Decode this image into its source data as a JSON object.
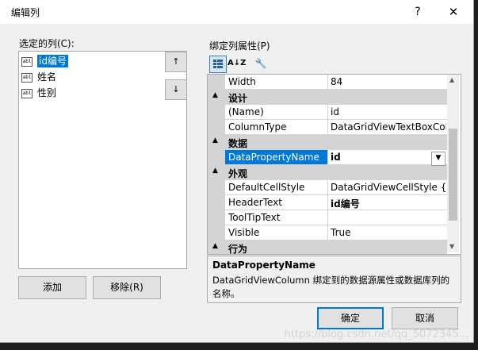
{
  "window": {
    "title": "编辑列",
    "help": "?",
    "close": "✕"
  },
  "left": {
    "label": "选定的列(C):",
    "columns": [
      {
        "name": "id编号",
        "icon": "abl",
        "selected": true
      },
      {
        "name": "姓名",
        "icon": "abl",
        "selected": false
      },
      {
        "name": "性别",
        "icon": "abl",
        "selected": false
      }
    ],
    "move_up": "↑",
    "move_down": "↓",
    "add_label": "添加",
    "remove_label": "移除(R)"
  },
  "right": {
    "label": "绑定列属性(P)",
    "toolbar": {
      "categorized": "categorized-icon",
      "alphabetical": "A↓Z",
      "property_pages": "wrench-icon"
    },
    "rows": [
      {
        "type": "prop",
        "name": "Width",
        "value": "84"
      },
      {
        "type": "cat",
        "name": "设计",
        "toggle": "▲"
      },
      {
        "type": "prop",
        "name": "(Name)",
        "value": "id"
      },
      {
        "type": "prop",
        "name": "ColumnType",
        "value": "DataGridViewTextBoxColu"
      },
      {
        "type": "cat",
        "name": "数据",
        "toggle": "▲"
      },
      {
        "type": "prop",
        "name": "DataPropertyName",
        "value": "id",
        "selected": true,
        "bold": true
      },
      {
        "type": "cat",
        "name": "外观",
        "toggle": "▲"
      },
      {
        "type": "prop",
        "name": "DefaultCellStyle",
        "value": "DataGridViewCellStyle { }"
      },
      {
        "type": "prop",
        "name": "HeaderText",
        "value": "id编号",
        "bold": true
      },
      {
        "type": "prop",
        "name": "ToolTipText",
        "value": ""
      },
      {
        "type": "prop",
        "name": "Visible",
        "value": "True"
      },
      {
        "type": "cat",
        "name": "行为",
        "toggle": "▲"
      }
    ],
    "description": {
      "title": "DataPropertyName",
      "text": "DataGridViewColumn 绑定到的数据源属性或数据库列的名称。"
    }
  },
  "buttons": {
    "ok": "确定",
    "cancel": "取消"
  },
  "watermark": "https://blog.csdn.net/qq_5072345..."
}
